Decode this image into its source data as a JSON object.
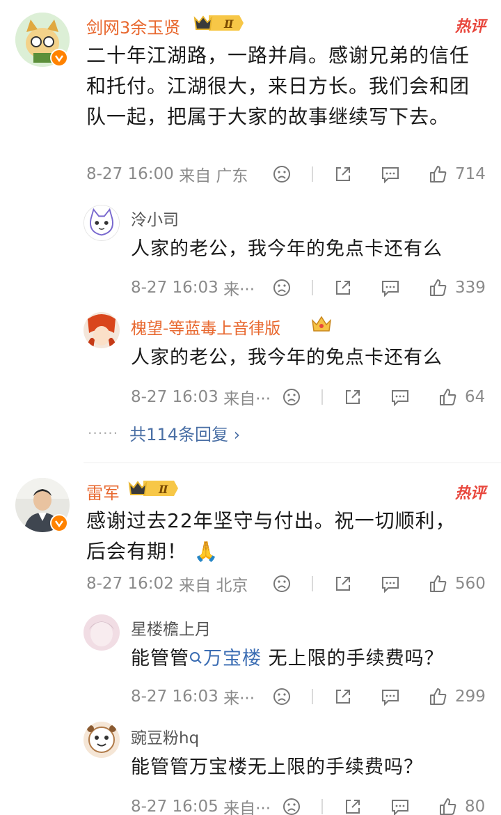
{
  "comments": [
    {
      "username": "剑网3余玉贤",
      "badge": "Ⅱ",
      "hot_label": "热评",
      "text": "二十年江湖路，一路并肩。感谢兄弟的信任和托付。江湖很大，来日方长。我们会和团队一起，把属于大家的故事继续写下去。",
      "time": "8-27 16:00",
      "source": "来自 广东",
      "likes": "714",
      "replies": [
        {
          "username": "泠小司",
          "text": "人家的老公，我今年的免点卡还有么",
          "time": "8-27 16:03",
          "source": "来···",
          "likes": "339"
        },
        {
          "username": "槐望-等蓝毒上音律版",
          "text": "人家的老公，我今年的免点卡还有么",
          "time": "8-27 16:03",
          "source": "来自···",
          "likes": "64"
        }
      ],
      "more_replies": "共114条回复 ›"
    },
    {
      "username": "雷军",
      "badge": "Ⅱ",
      "hot_label": "热评",
      "text": "感谢过去22年坚守与付出。祝一切顺利，后会有期！",
      "emoji": "🙏",
      "time": "8-27 16:02",
      "source": "来自 北京",
      "likes": "560",
      "replies": [
        {
          "username": "星楼檐上月",
          "text_before": "能管管",
          "search_link": "万宝楼",
          "text_after": " 无上限的手续费吗？",
          "time": "8-27 16:03",
          "source": "来···",
          "likes": "299"
        },
        {
          "username": "豌豆粉hq",
          "text": "能管管万宝楼无上限的手续费吗？",
          "time": "8-27 16:05",
          "source": "来自···",
          "likes": "80"
        }
      ]
    }
  ],
  "more_dots": "······",
  "colors": {
    "username": "#e8682f",
    "hot": "#e8473d",
    "link": "#4a6fa5",
    "meta": "#8a8a8a"
  }
}
